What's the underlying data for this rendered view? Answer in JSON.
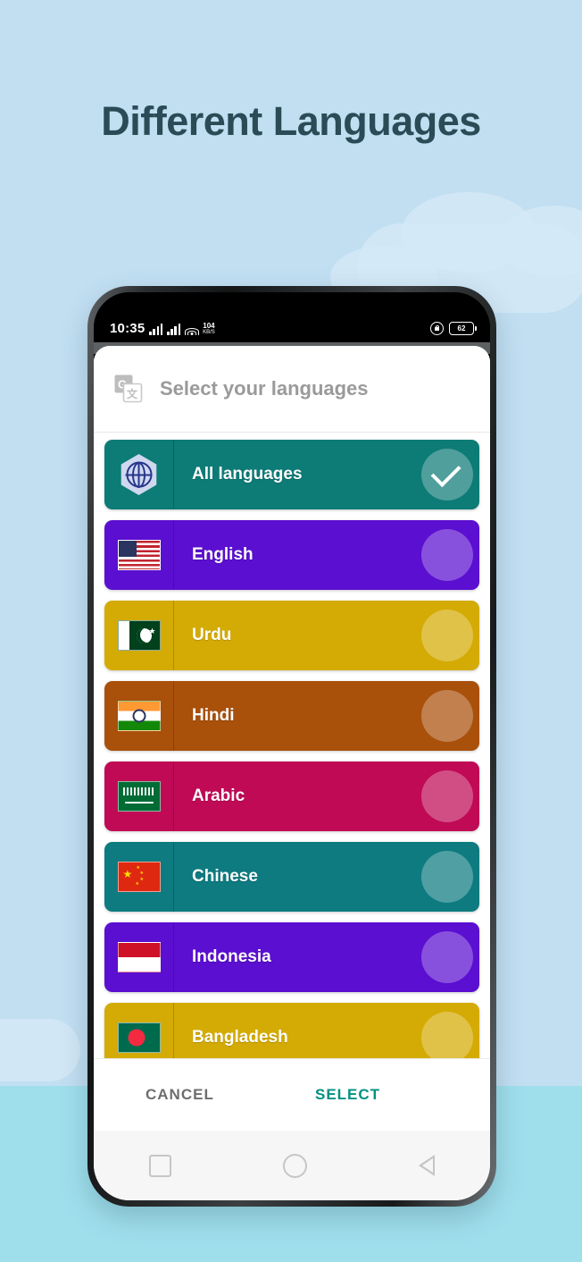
{
  "page": {
    "heading": "Different Languages",
    "heading_color": "#2b4b56",
    "bg_sky_color": "#c2dff2",
    "bg_water_color": "#9fdfec"
  },
  "status_bar": {
    "time": "10:35",
    "net_speed_value": "104",
    "net_speed_unit": "KB/S",
    "signal_icon": "signal-bars-icon",
    "wifi_icon": "wifi-icon",
    "lock_icon": "lock-icon",
    "battery_level": "62"
  },
  "dialog": {
    "app_icon": "google-translate-icon",
    "title": "Select your languages",
    "title_color": "#9a9a9a",
    "cancel_label": "CANCEL",
    "select_label": "SELECT",
    "select_color": "#009181",
    "cancel_color": "#6e6e6e"
  },
  "languages": [
    {
      "name": "All languages",
      "icon": "globe-hexagon-icon",
      "color": "#0d7b76",
      "selected": true,
      "flag": "none"
    },
    {
      "name": "English",
      "icon": "flag-united-states-icon",
      "color": "#5b0fd0",
      "selected": false,
      "flag": "us"
    },
    {
      "name": "Urdu",
      "icon": "flag-pakistan-icon",
      "color": "#d4ab04",
      "selected": false,
      "flag": "pk"
    },
    {
      "name": "Hindi",
      "icon": "flag-india-icon",
      "color": "#a9500b",
      "selected": false,
      "flag": "in"
    },
    {
      "name": "Arabic",
      "icon": "flag-saudi-arabia-icon",
      "color": "#c00a56",
      "selected": false,
      "flag": "sa"
    },
    {
      "name": "Chinese",
      "icon": "flag-china-icon",
      "color": "#0d7b80",
      "selected": false,
      "flag": "cn"
    },
    {
      "name": "Indonesia",
      "icon": "flag-indonesia-icon",
      "color": "#5b0fd0",
      "selected": false,
      "flag": "id"
    },
    {
      "name": "Bangladesh",
      "icon": "flag-bangladesh-icon",
      "color": "#d4ab04",
      "selected": false,
      "flag": "bd"
    }
  ],
  "nav_bar": {
    "recents_icon": "square-recents-icon",
    "home_icon": "circle-home-icon",
    "back_icon": "triangle-back-icon"
  }
}
